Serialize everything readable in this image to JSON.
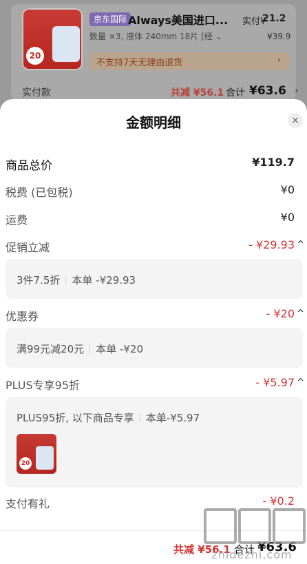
{
  "background": {
    "store_tag": "京东国际",
    "product_title": "Always美国进口...",
    "actual_pay_label": "实付¥",
    "actual_pay_amount": "21.2",
    "spec": "数量 ×3, 液体 240mm 18片 [经 ⌄",
    "original_price": "¥39.9",
    "notice": "不支持7天无理由退货",
    "notice_chevron": "›",
    "actual_label": "实付款",
    "total_discount": "共减 ¥56.1",
    "total_label": "合计",
    "total_amount": "¥63.6",
    "total_chevron": "›",
    "thumb_badge": "20"
  },
  "sheet": {
    "title": "金额明细",
    "close_icon": "×",
    "rows": {
      "goods_total": {
        "label": "商品总价",
        "value": "¥119.7"
      },
      "tax": {
        "label": "税费 (已包税)",
        "value": "¥0"
      },
      "shipping": {
        "label": "运费",
        "value": "¥0"
      },
      "promo": {
        "label": "促销立减",
        "value": "- ¥29.93",
        "caret": "^"
      },
      "coupon": {
        "label": "优惠券",
        "value": "- ¥20",
        "caret": "^"
      },
      "plus": {
        "label": "PLUS专享95折",
        "value": "- ¥5.97",
        "caret": "^"
      },
      "gift": {
        "label": "支付有礼",
        "value": "- ¥0.2"
      }
    },
    "details": {
      "promo_a": "3件7.5折",
      "promo_b": "本单 -¥29.93",
      "coupon_a": "满99元减20元",
      "coupon_b": "本单 -¥20",
      "plus_a": "PLUS95折, 以下商品专享",
      "plus_b": "本单-¥5.97",
      "plus_thumb_badge": "20"
    }
  },
  "footer": {
    "discount": "共减 ¥56.1",
    "total_label": "合计",
    "total_amount": "¥63.6"
  },
  "watermark": {
    "text": "zhidezhi.com"
  },
  "colors": {
    "accent_red": "#d13434",
    "overlay": "#6f6f6f",
    "panel_bg": "#f4f4f4"
  }
}
